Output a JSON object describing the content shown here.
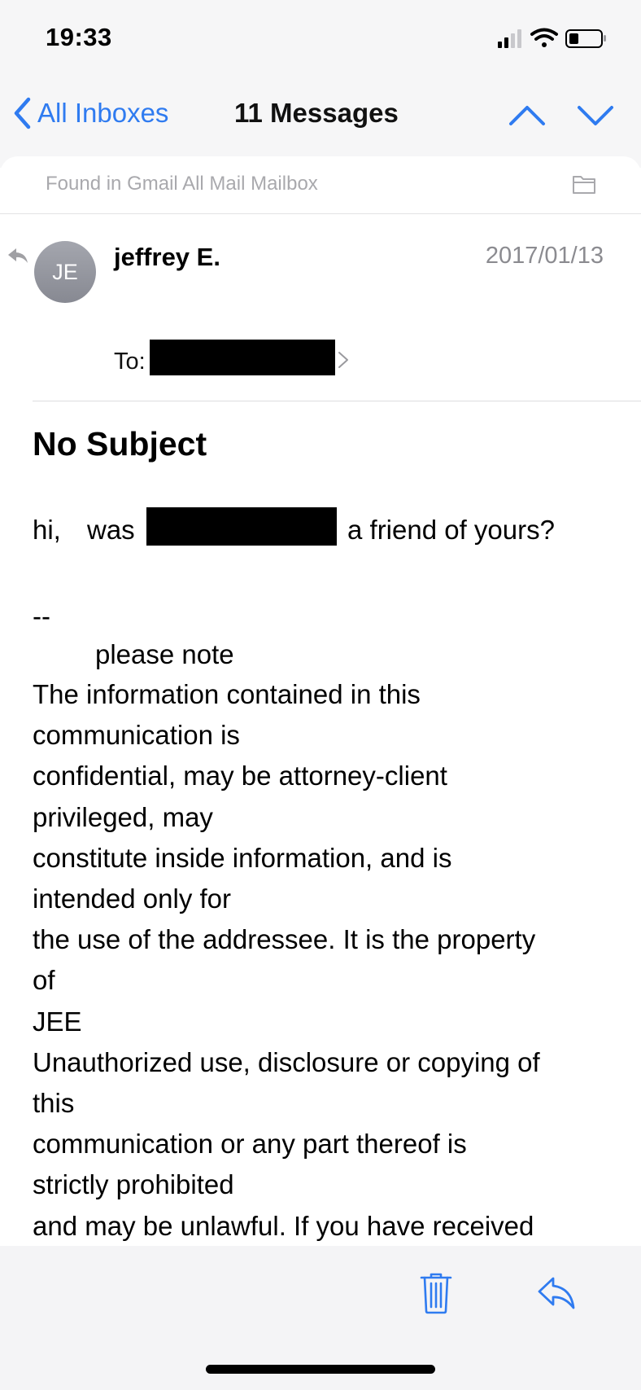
{
  "status_bar": {
    "time": "19:33"
  },
  "nav": {
    "back_label": "All Inboxes",
    "title": "11 Messages"
  },
  "mailbox_notice": "Found in Gmail All Mail Mailbox",
  "message": {
    "avatar_initials": "JE",
    "sender": "jeffrey E.",
    "date": "2017/01/13",
    "to_label": "To:",
    "subject": "No Subject",
    "body_greeting_start": "hi,",
    "body_greeting_mid": "was",
    "body_greeting_end": "a friend of yours?",
    "signature_dash": "--",
    "signature_note": "please note",
    "disclaimer_lines": [
      "The information contained in this",
      "communication is",
      "confidential, may be attorney-client",
      "privileged, may",
      "constitute inside information, and is",
      "intended only for",
      "the use of the addressee. It is the property",
      "of",
      "JEE",
      "Unauthorized use, disclosure or copying of",
      "this",
      "communication or any part thereof is",
      "strictly prohibited",
      "and may be unlawful. If you have received"
    ]
  },
  "icons": {
    "back": "chevron-left-icon",
    "prev": "chevron-up-icon",
    "next": "chevron-down-icon",
    "folder": "folder-icon",
    "trash": "trash-icon",
    "reply": "reply-icon"
  },
  "colors": {
    "accent": "#2f7bf0",
    "secondary_text": "#8b8b90",
    "redaction": "#000000"
  }
}
